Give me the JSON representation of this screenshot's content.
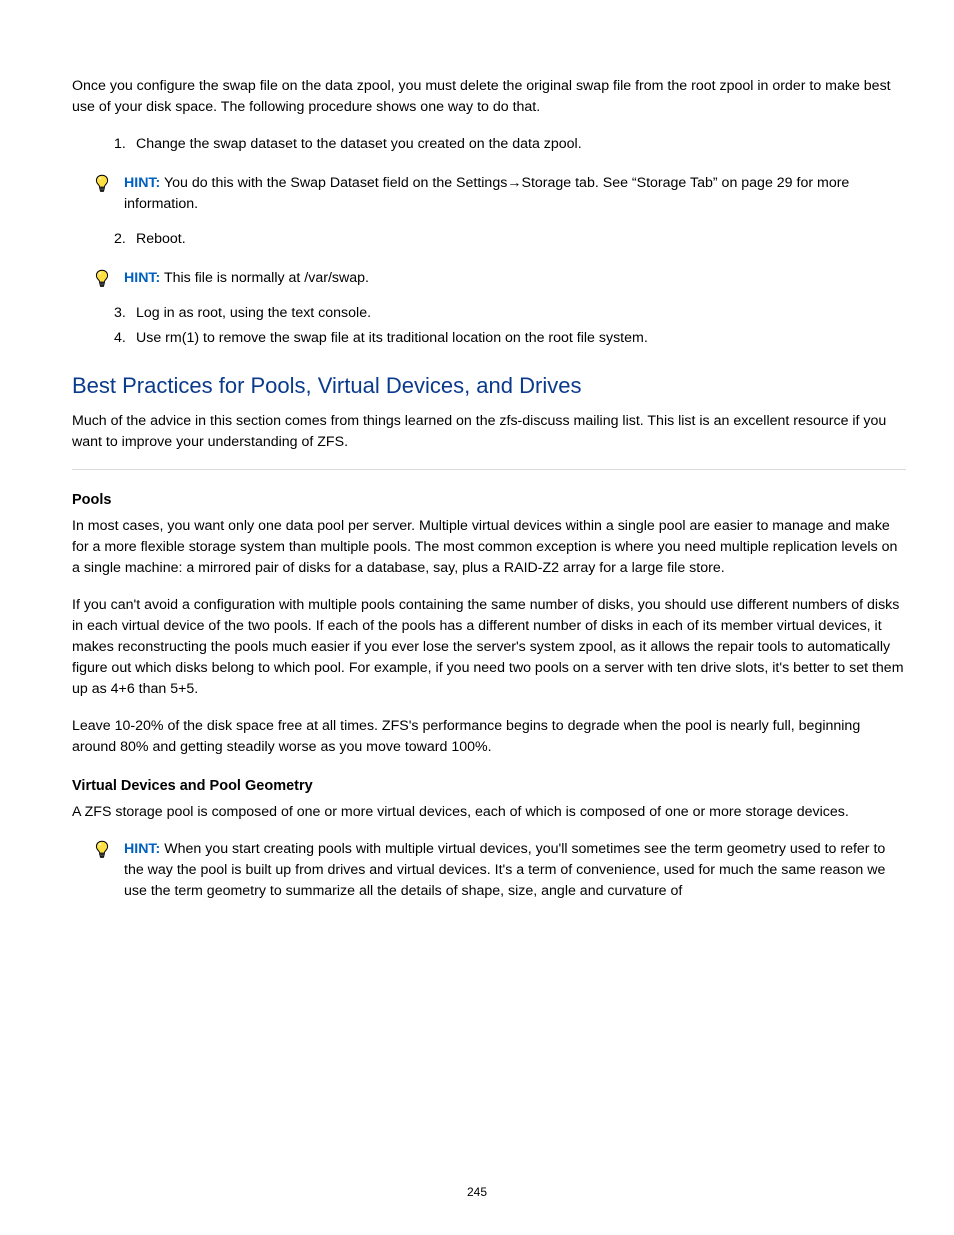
{
  "intro_para": "Once you configure the swap file on the data zpool, you must delete the original swap file from the root zpool in order to make best use of your disk space. The following procedure shows one way to do that.",
  "steps": [
    "Change the swap dataset to the dataset you created on the data zpool.",
    "Reboot.",
    "Log in as root, using the text console.",
    "Use rm(1) to remove the swap file at its traditional location on the root file system."
  ],
  "tip_label": "HINT:",
  "tips": [
    "You do this with the Swap Dataset field on the Settings→Storage tab. See “Storage Tab” on page 29 for more information.",
    "This file is normally at /var/swap."
  ],
  "section_title": "Best Practices for Pools, Virtual Devices, and Drives",
  "section_para": "Much of the advice in this section comes from things learned on the zfs-discuss mailing list. This list is an excellent resource if you want to improve your understanding of ZFS.",
  "h_pools": "Pools",
  "pools_paras": [
    "In most cases, you want only one data pool per server. Multiple virtual devices within a single pool are easier to manage and make for a more flexible storage system than multiple pools. The most common exception is where you need multiple replication levels on a single machine: a mirrored pair of disks for a database, say, plus a RAID-Z2 array for a large file store.",
    "If you can't avoid a configuration with multiple pools containing the same number of disks, you should use different numbers of disks in each virtual device of the two pools. If each of the pools has a different number of disks in each of its member virtual devices, it makes reconstructing the pools much easier if you ever lose the server's system zpool, as it allows the repair tools to automatically figure out which disks belong to which pool. For example, if you need two pools on a server with ten drive slots, it's better to set them up as 4+6 than 5+5.",
    "Leave 10-20% of the disk space free at all times. ZFS's performance begins to degrade when the pool is nearly full, beginning around 80% and getting steadily worse as you move toward 100%."
  ],
  "h_vdev": "Virtual Devices and Pool Geometry",
  "vdev_para": "A ZFS storage pool is composed of one or more virtual devices, each of which is composed of one or more storage devices.",
  "vdev_tip": "When you start creating pools with multiple virtual devices, you'll sometimes see the term geometry used to refer to the way the pool is built up from drives and virtual devices. It's a term of convenience, used for much the same reason we use the term geometry to summarize all the details of shape, size, angle and curvature of",
  "page_number": "245"
}
